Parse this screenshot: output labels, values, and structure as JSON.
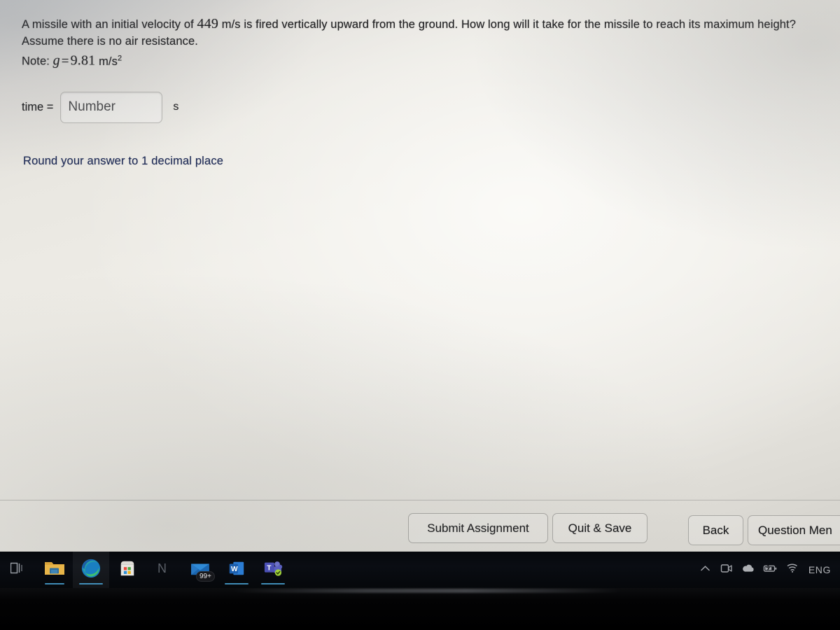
{
  "question": {
    "line1_part1": "A missile with an initial velocity of",
    "line1_value": "449",
    "line1_part2": "m/s is fired vertically upward from the ground. How long will it take for the missile to reach its maximum height?",
    "line2": "Assume there is no air resistance.",
    "note_label": "Note:",
    "note_var": "g",
    "note_eq": "=",
    "note_value": "9.81",
    "note_unit": "m/s",
    "note_unit_exp": "2"
  },
  "answer": {
    "label": "time =",
    "placeholder": "Number",
    "value": "",
    "unit": "s",
    "hint": "Round your answer to 1 decimal place",
    "hint_color": "#1d2a55"
  },
  "buttons": {
    "submit": "Submit Assignment",
    "quit": "Quit & Save",
    "back": "Back",
    "question_menu": "Question Men"
  },
  "taskbar": {
    "items": [
      {
        "name": "task-view-icon",
        "label": "Task View",
        "active": false,
        "underline": false,
        "badge": ""
      },
      {
        "name": "file-explorer-icon",
        "label": "File Explorer",
        "active": false,
        "underline": true,
        "badge": ""
      },
      {
        "name": "microsoft-edge-icon",
        "label": "Microsoft Edge",
        "active": true,
        "underline": true,
        "badge": ""
      },
      {
        "name": "microsoft-store-icon",
        "label": "Microsoft Store",
        "active": false,
        "underline": false,
        "badge": ""
      },
      {
        "name": "onenote-icon",
        "label": "N",
        "active": false,
        "underline": false,
        "badge": ""
      },
      {
        "name": "mail-icon",
        "label": "Mail",
        "active": false,
        "underline": false,
        "badge": "99+"
      },
      {
        "name": "word-icon",
        "label": "W",
        "active": false,
        "underline": true,
        "badge": ""
      },
      {
        "name": "teams-icon",
        "label": "T",
        "active": false,
        "underline": true,
        "badge": ""
      }
    ],
    "tray": [
      {
        "name": "show-hidden-icons-chevron-up-icon",
        "label": "Show hidden icons"
      },
      {
        "name": "camera-device-icon",
        "label": "Camera"
      },
      {
        "name": "onedrive-cloud-icon",
        "label": "OneDrive"
      },
      {
        "name": "battery-charging-icon",
        "label": "Battery"
      },
      {
        "name": "wifi-icon",
        "label": "Network"
      }
    ],
    "language": "ENG"
  }
}
